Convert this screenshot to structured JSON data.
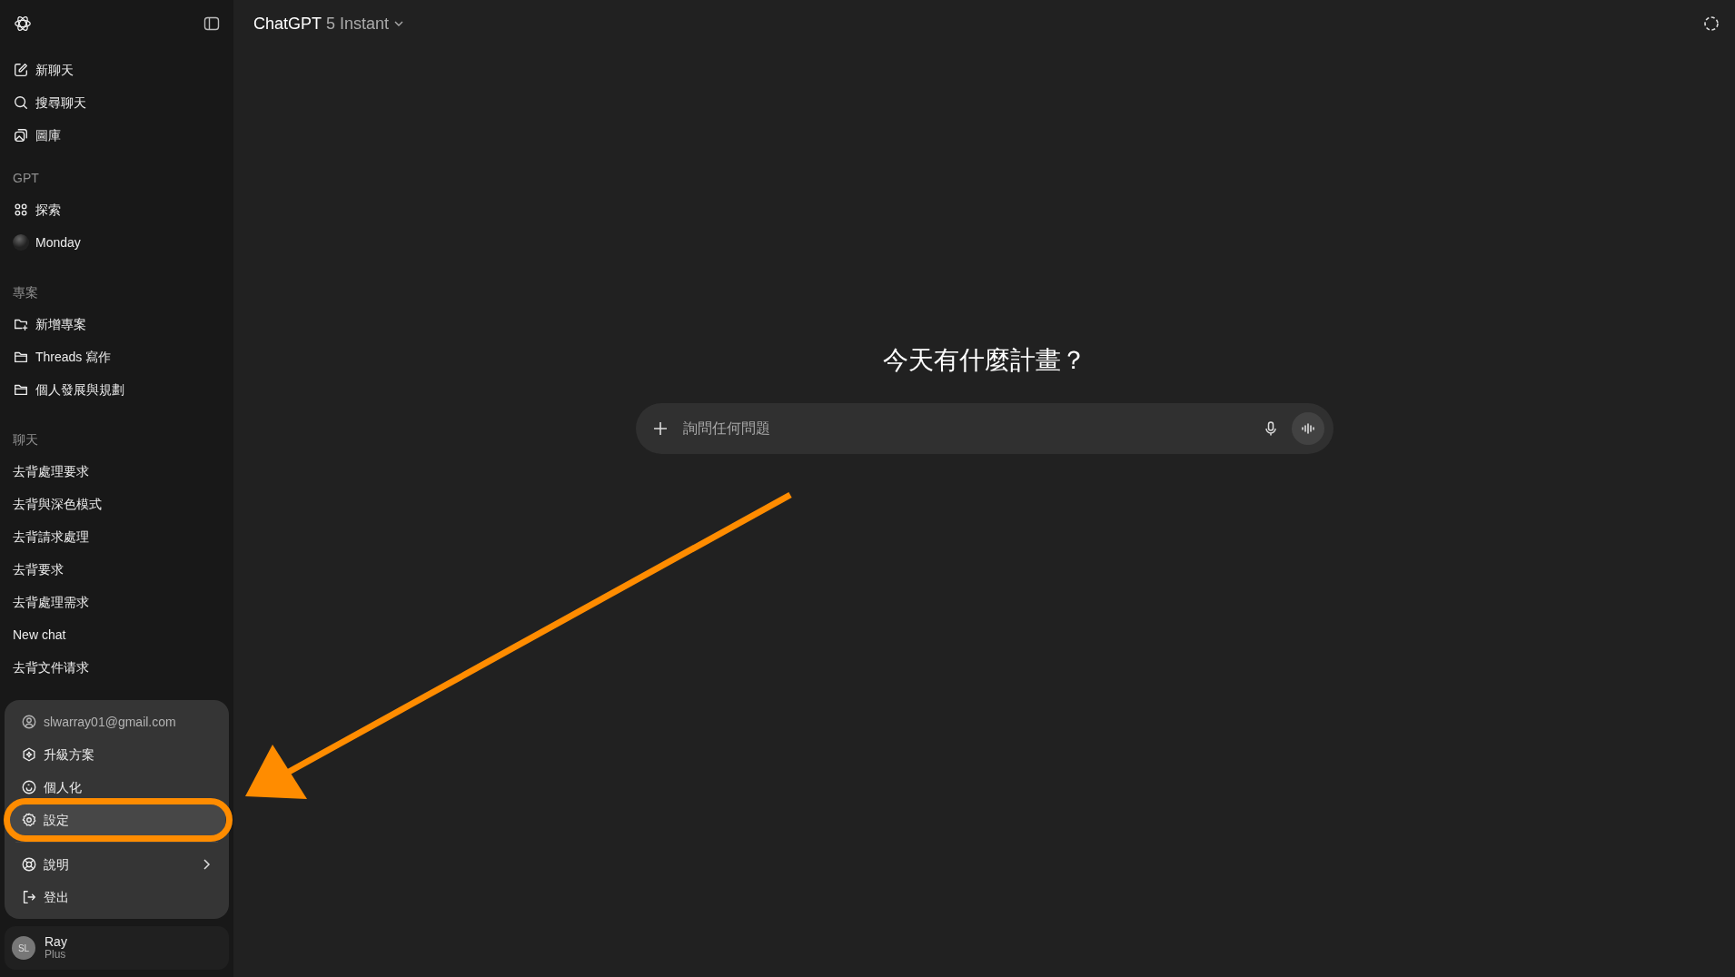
{
  "header": {
    "title": "ChatGPT",
    "model": "5 Instant"
  },
  "sidebar": {
    "top_items": [
      {
        "label": "新聊天"
      },
      {
        "label": "搜尋聊天"
      },
      {
        "label": "圖庫"
      }
    ],
    "sections": [
      {
        "heading": "GPT",
        "items": [
          {
            "label": "探索"
          },
          {
            "label": "Monday"
          }
        ]
      },
      {
        "heading": "專案",
        "items": [
          {
            "label": "新增專案"
          },
          {
            "label": "Threads 寫作"
          },
          {
            "label": "個人發展與規劃"
          }
        ]
      }
    ],
    "chats": {
      "heading": "聊天",
      "items": [
        {
          "label": "去背處理要求"
        },
        {
          "label": "去背與深色模式"
        },
        {
          "label": "去背請求處理"
        },
        {
          "label": "去背要求"
        },
        {
          "label": "去背處理需求"
        },
        {
          "label": "New chat"
        },
        {
          "label": "去背文件请求"
        }
      ]
    }
  },
  "account_menu": {
    "items": [
      {
        "label": "slwarray01@gmail.com",
        "kind": "info",
        "selected": false,
        "circled": false
      },
      {
        "label": "升級方案",
        "kind": "action",
        "selected": false,
        "circled": false
      },
      {
        "label": "個人化",
        "kind": "action",
        "selected": false,
        "circled": false
      },
      {
        "label": "設定",
        "kind": "action",
        "selected": true,
        "circled": true
      },
      {
        "label": "說明",
        "kind": "submenu",
        "selected": false,
        "circled": false
      },
      {
        "label": "登出",
        "kind": "action",
        "selected": false,
        "circled": false
      }
    ]
  },
  "profile": {
    "initials": "SL",
    "name": "Ray",
    "plan": "Plus"
  },
  "main": {
    "heading": "今天有什麼計畫？",
    "composer": {
      "placeholder": "詢問任何問題"
    }
  },
  "annotations": [
    {
      "kind": "arrow"
    }
  ]
}
